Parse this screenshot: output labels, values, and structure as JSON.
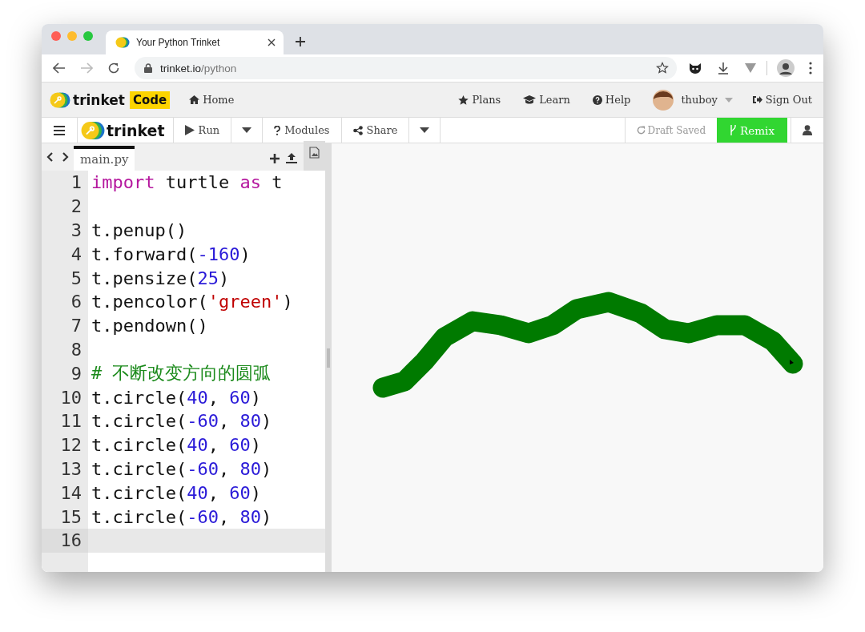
{
  "browser": {
    "tab_title": "Your Python Trinket",
    "url_host": "trinket.io",
    "url_path": "/python"
  },
  "site_nav": {
    "brand": "trinket",
    "brand_badge": "Code",
    "links": [
      {
        "kind": "home",
        "label": "Home"
      },
      {
        "kind": "star",
        "label": "Plans"
      },
      {
        "kind": "cap",
        "label": "Learn"
      },
      {
        "kind": "help",
        "label": "Help"
      }
    ],
    "user": "thuboy",
    "sign_out": "Sign Out"
  },
  "toolbar": {
    "brand": "trinket",
    "run": "Run",
    "modules": "Modules",
    "share": "Share",
    "status": "Draft Saved",
    "remix": "Remix"
  },
  "editor": {
    "file_tab": "main.py",
    "lines": [
      {
        "number": "1",
        "active": false,
        "tokens": [
          {
            "kind": "keyword",
            "text": "import"
          },
          {
            "kind": "plain",
            "text": " turtle "
          },
          {
            "kind": "keyword",
            "text": "as"
          },
          {
            "kind": "plain",
            "text": " t"
          }
        ]
      },
      {
        "number": "2",
        "active": false
      },
      {
        "number": "3",
        "active": false,
        "tokens": [
          {
            "kind": "plain",
            "text": "t.penup()"
          }
        ]
      },
      {
        "number": "4",
        "active": false,
        "tokens": [
          {
            "kind": "plain",
            "text": "t.forward("
          },
          {
            "kind": "number",
            "text": "-160"
          },
          {
            "kind": "plain",
            "text": ")"
          }
        ]
      },
      {
        "number": "5",
        "active": false,
        "tokens": [
          {
            "kind": "plain",
            "text": "t.pensize("
          },
          {
            "kind": "number",
            "text": "25"
          },
          {
            "kind": "plain",
            "text": ")"
          }
        ]
      },
      {
        "number": "6",
        "active": false,
        "tokens": [
          {
            "kind": "plain",
            "text": "t.pencolor("
          },
          {
            "kind": "string",
            "text": "'green'"
          },
          {
            "kind": "plain",
            "text": ")"
          }
        ]
      },
      {
        "number": "7",
        "active": false,
        "tokens": [
          {
            "kind": "plain",
            "text": "t.pendown()"
          }
        ]
      },
      {
        "number": "8",
        "active": false
      },
      {
        "number": "9",
        "active": false,
        "tokens": [
          {
            "kind": "comment",
            "text": "# 不断改变方向的圆弧"
          }
        ]
      },
      {
        "number": "10",
        "active": false,
        "tokens": [
          {
            "kind": "plain",
            "text": "t.circle("
          },
          {
            "kind": "number",
            "text": "40"
          },
          {
            "kind": "plain",
            "text": ", "
          },
          {
            "kind": "number",
            "text": "60"
          },
          {
            "kind": "plain",
            "text": ")"
          }
        ]
      },
      {
        "number": "11",
        "active": false,
        "tokens": [
          {
            "kind": "plain",
            "text": "t.circle("
          },
          {
            "kind": "number",
            "text": "-60"
          },
          {
            "kind": "plain",
            "text": ", "
          },
          {
            "kind": "number",
            "text": "80"
          },
          {
            "kind": "plain",
            "text": ")"
          }
        ]
      },
      {
        "number": "12",
        "active": false,
        "tokens": [
          {
            "kind": "plain",
            "text": "t.circle("
          },
          {
            "kind": "number",
            "text": "40"
          },
          {
            "kind": "plain",
            "text": ", "
          },
          {
            "kind": "number",
            "text": "60"
          },
          {
            "kind": "plain",
            "text": ")"
          }
        ]
      },
      {
        "number": "13",
        "active": false,
        "tokens": [
          {
            "kind": "plain",
            "text": "t.circle("
          },
          {
            "kind": "number",
            "text": "-60"
          },
          {
            "kind": "plain",
            "text": ", "
          },
          {
            "kind": "number",
            "text": "80"
          },
          {
            "kind": "plain",
            "text": ")"
          }
        ]
      },
      {
        "number": "14",
        "active": false,
        "tokens": [
          {
            "kind": "plain",
            "text": "t.circle("
          },
          {
            "kind": "number",
            "text": "40"
          },
          {
            "kind": "plain",
            "text": ", "
          },
          {
            "kind": "number",
            "text": "60"
          },
          {
            "kind": "plain",
            "text": ")"
          }
        ]
      },
      {
        "number": "15",
        "active": false,
        "tokens": [
          {
            "kind": "plain",
            "text": "t.circle("
          },
          {
            "kind": "number",
            "text": "-60"
          },
          {
            "kind": "plain",
            "text": ", "
          },
          {
            "kind": "number",
            "text": "80"
          },
          {
            "kind": "plain",
            "text": ")"
          }
        ]
      },
      {
        "number": "16",
        "active": true
      }
    ]
  }
}
